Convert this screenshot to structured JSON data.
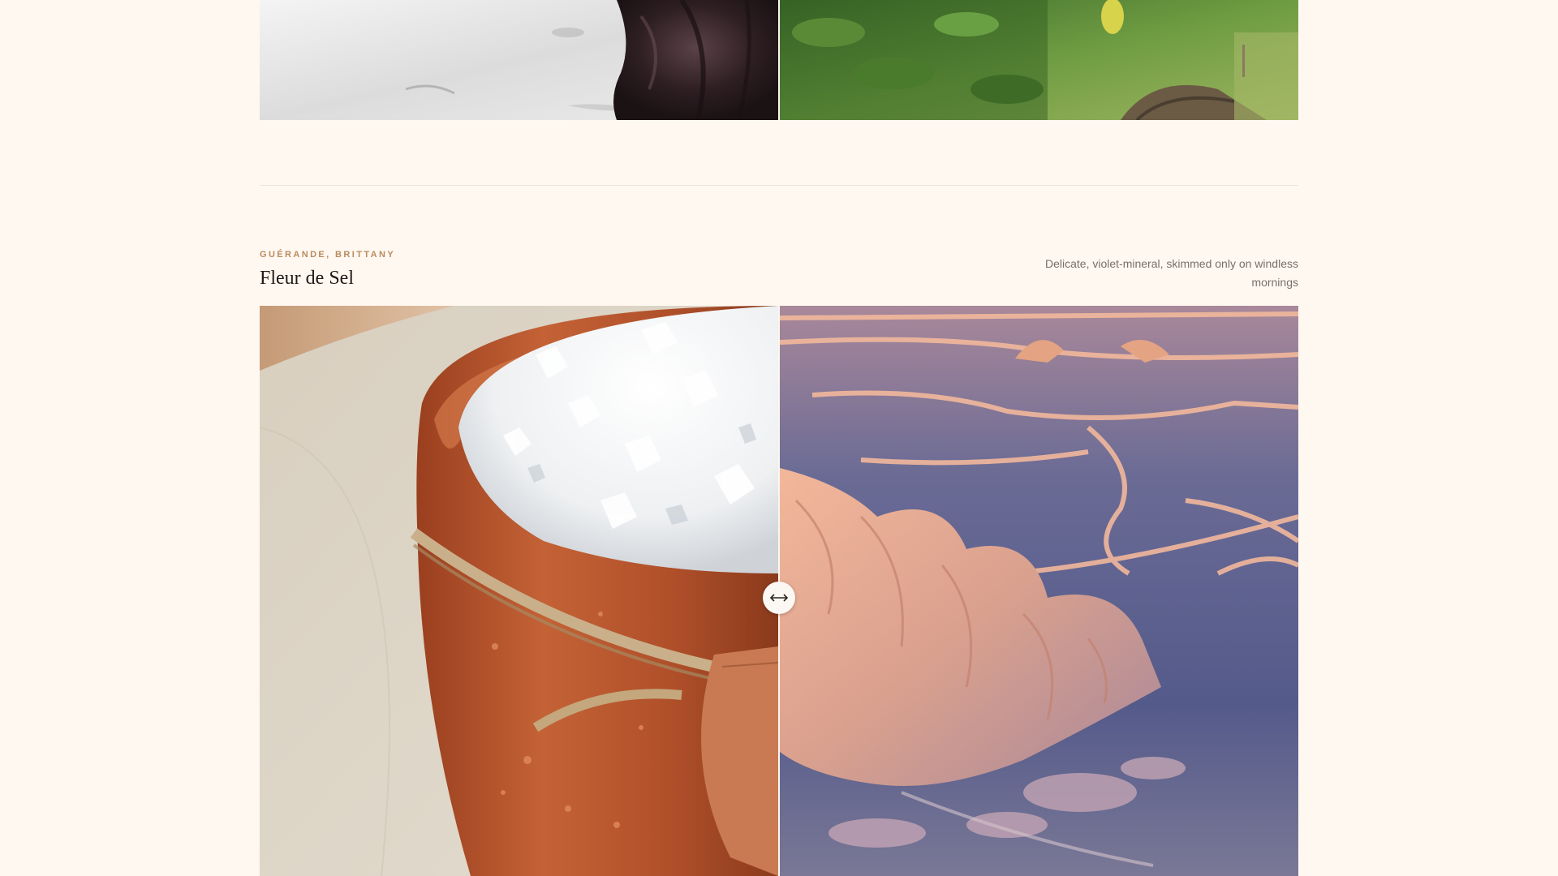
{
  "previous_section": {
    "left_image": "vanilla-pod-on-marble",
    "right_image": "vanilla-vines-on-plantation"
  },
  "section": {
    "eyebrow": "GUÉRANDE, BRITTANY",
    "title": "Fleur de Sel",
    "description": "Delicate, violet-mineral, skimmed only on windless mornings",
    "comparison": {
      "left_image": "salt-crystals-in-terracotta-pot",
      "right_image": "salt-marsh-crystals-at-dusk",
      "handle_icon": "left-right-arrows-icon"
    }
  },
  "colors": {
    "background": "#fff8f1",
    "eyebrow": "#b98b5e",
    "title": "#1f1a16",
    "description": "#77706a",
    "rule": "#ece4da"
  }
}
